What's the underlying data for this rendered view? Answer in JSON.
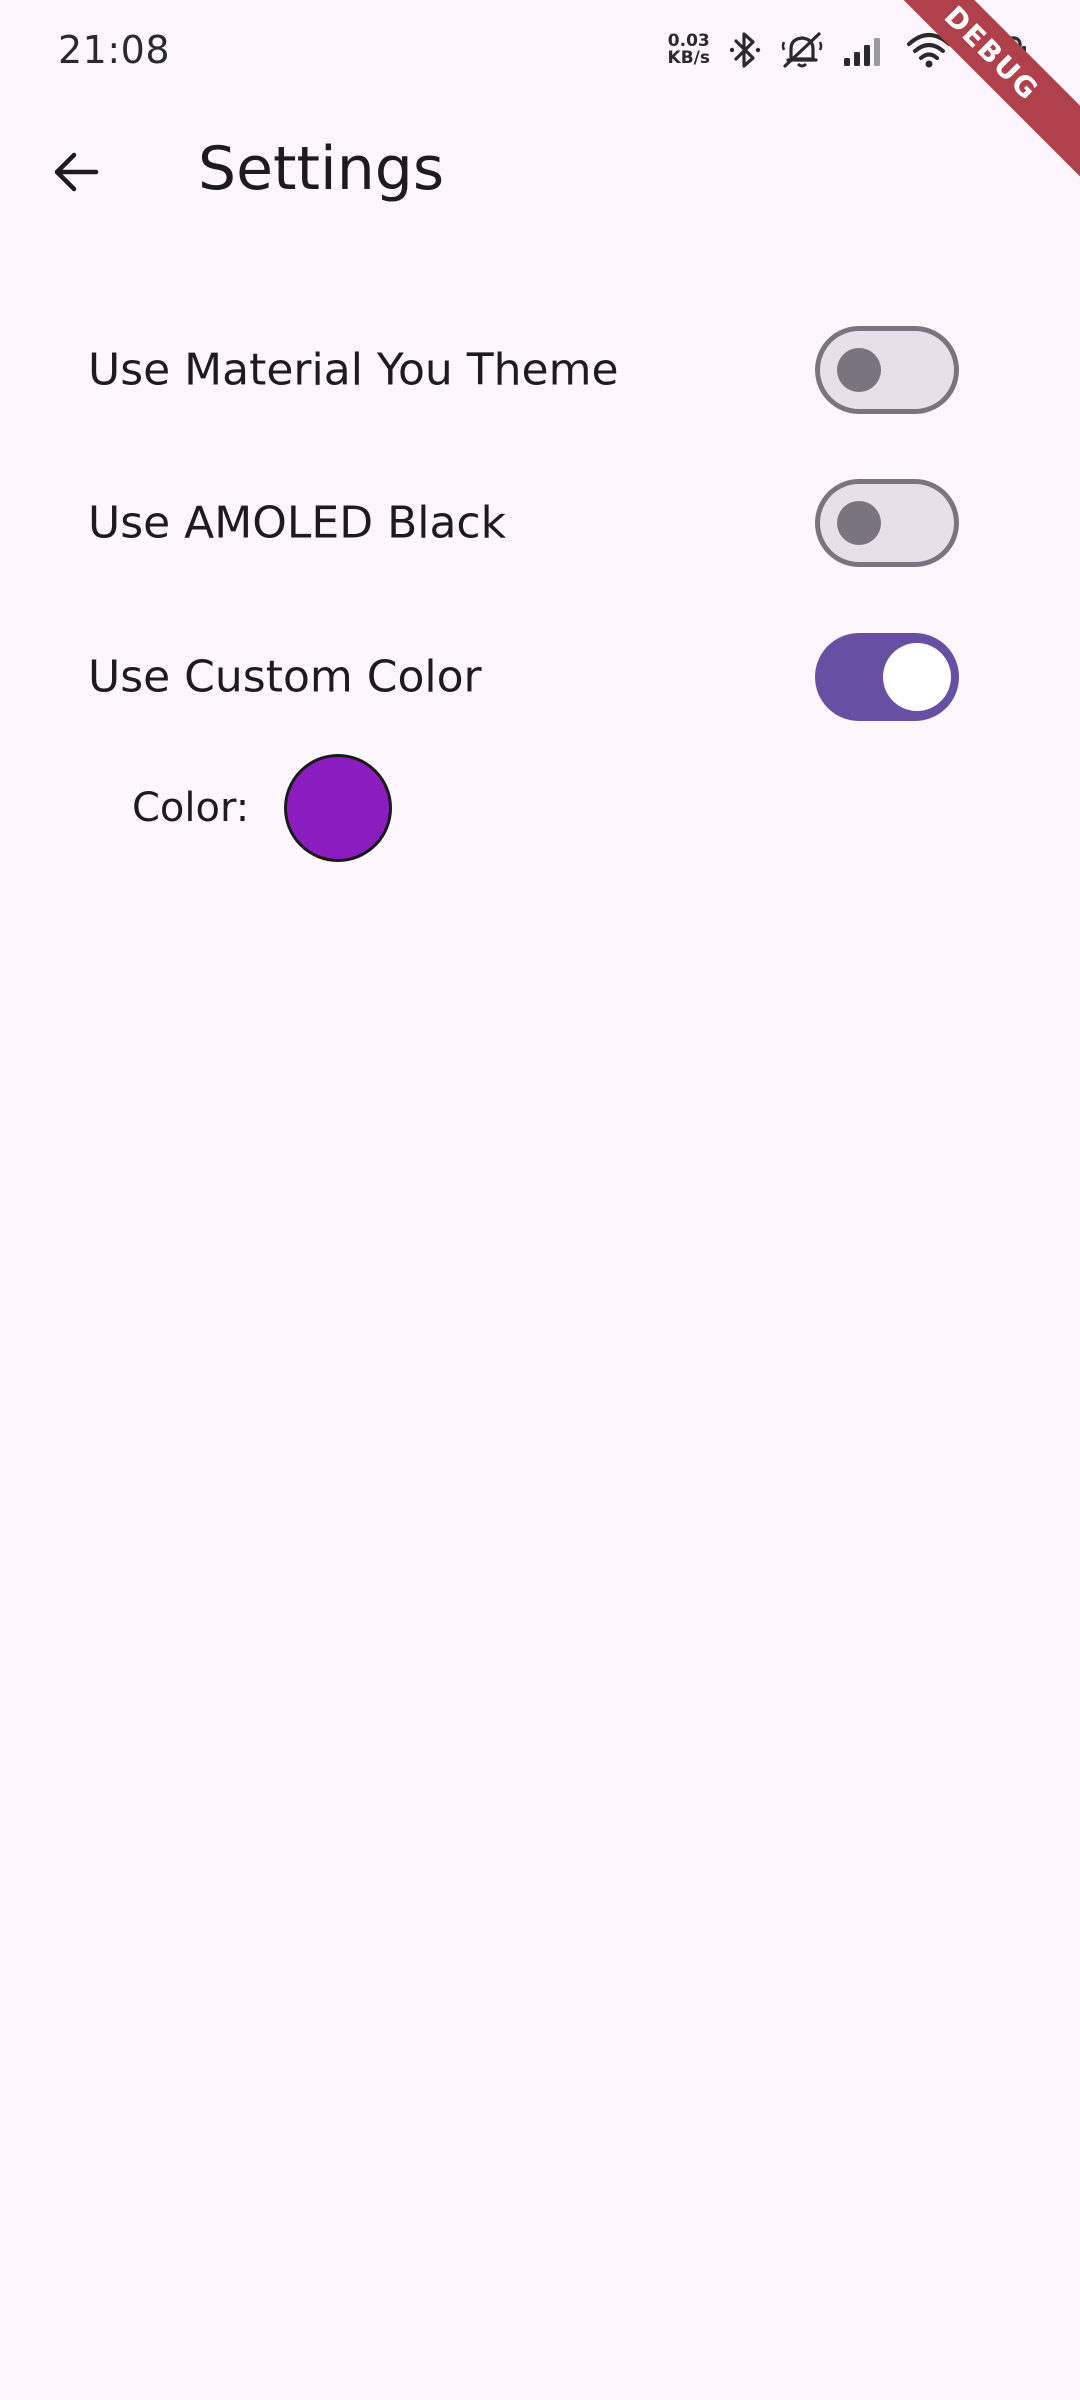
{
  "status_bar": {
    "time": "21:08",
    "netspeed_value": "0.03",
    "netspeed_unit": "KB/s",
    "icons": [
      "bluetooth-icon",
      "mute-icon",
      "signal-icon",
      "wifi-icon",
      "battery-icon"
    ]
  },
  "debug_banner": {
    "label": "DEBUG"
  },
  "app_bar": {
    "title": "Settings",
    "back_icon": "arrow-back-icon"
  },
  "settings": [
    {
      "label": "Use Material You Theme",
      "enabled": false
    },
    {
      "label": "Use AMOLED Black",
      "enabled": false
    },
    {
      "label": "Use Custom Color",
      "enabled": true
    }
  ],
  "custom_color": {
    "label": "Color:",
    "value": "#8b1cc0"
  },
  "colors": {
    "background": "#fdf7fd",
    "switch_on_track": "#6750a4",
    "switch_off_track": "#e7e0e9",
    "switch_off_outline": "#79747e",
    "debug_banner": "#b0404a"
  }
}
